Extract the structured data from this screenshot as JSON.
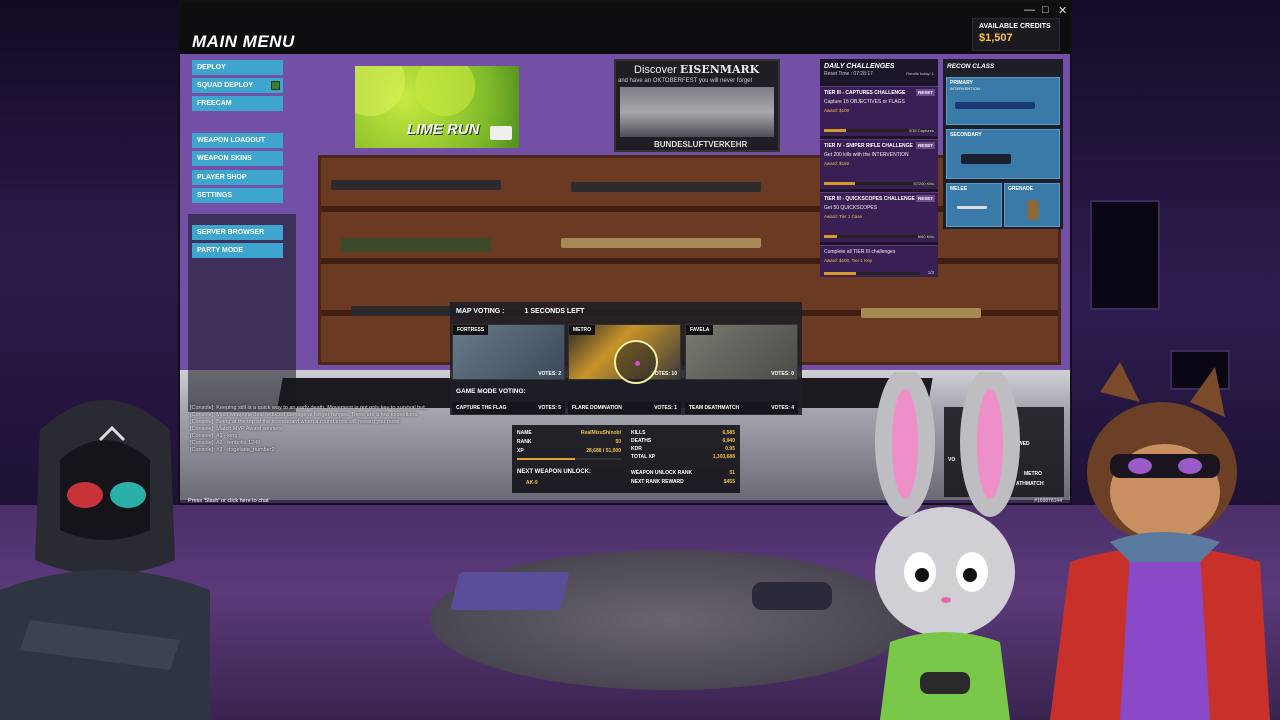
{
  "window": {
    "title": "MAIN MENU",
    "controls": [
      "—",
      "□",
      "✕"
    ]
  },
  "credits": {
    "label": "AVAILABLE CREDITS",
    "amount": "$1,507"
  },
  "menu": {
    "primary": [
      {
        "label": "DEPLOY"
      },
      {
        "label": "SQUAD DEPLOY",
        "checkbox": true
      },
      {
        "label": "FREECAM"
      }
    ],
    "secondary": [
      {
        "label": "WEAPON LOADOUT"
      },
      {
        "label": "WEAPON SKINS"
      },
      {
        "label": "PLAYER SHOP"
      },
      {
        "label": "SETTINGS"
      }
    ],
    "tertiary": [
      {
        "label": "SERVER BROWSER"
      },
      {
        "label": "PARTY MODE"
      }
    ]
  },
  "ads": {
    "lime": {
      "text": "LIME RUN"
    },
    "eisenmark": {
      "line1_prefix": "Discover",
      "line1_brand": "EISENMARK",
      "line2": "and have an OKTOBERFEST you will never forget",
      "line3": "BUNDESLUFTVERKEHR"
    }
  },
  "challenges": {
    "title": "DAILY CHALLENGES",
    "reset": "Reset Time : 07:28:17",
    "rerolls": "Rerolls today: 1",
    "items": [
      {
        "title": "TIER III - CAPTURES CHALLENGE",
        "reset": "RESET",
        "desc": "Capture 15 OBJECTIVES or FLAGS",
        "award": "Award: $100",
        "progress": "3/15 Captures",
        "fill": 0.2
      },
      {
        "title": "TIER IV - SNIPER RIFLE CHALLENGE",
        "reset": "RESET",
        "desc": "Get 200 kills with the INTERVENTION",
        "award": "Award: $150",
        "progress": "57/200 Kills",
        "fill": 0.285
      },
      {
        "title": "TIER III - QUICKSCOPES CHALLENGE",
        "reset": "RESET",
        "desc": "Get 50 QUICKSCOPES",
        "award": "Award: Tier 1 Case",
        "progress": "6/50 Kills",
        "fill": 0.12
      }
    ],
    "final": {
      "desc": "Complete all TIER III challenges",
      "award": "Award: $100, Tier 1 Key",
      "progress": "1/3",
      "fill": 0.33
    }
  },
  "recon": {
    "title": "RECON CLASS",
    "primary": {
      "label": "PRIMARY",
      "weapon": "INTERVENTION"
    },
    "secondary": {
      "label": "SECONDARY"
    },
    "melee": {
      "label": "MELEE"
    },
    "grenade": {
      "label": "GRENADE"
    }
  },
  "voting": {
    "title": "MAP VOTING :",
    "timer": "1 SECONDS LEFT",
    "maps": [
      {
        "name": "FORTRESS",
        "votes": "VOTES: 2"
      },
      {
        "name": "METRO",
        "votes": "VOTES: 10"
      },
      {
        "name": "FAVELA",
        "votes": "VOTES: 0"
      }
    ],
    "mode_title": "GAME MODE VOTING:",
    "modes": [
      {
        "name": "CAPTURE THE FLAG",
        "votes": "VOTES: 5"
      },
      {
        "name": "FLARE DOMINATION",
        "votes": "VOTES: 1"
      },
      {
        "name": "TEAM DEATHMATCH",
        "votes": "VOTES: 4"
      }
    ]
  },
  "chat": {
    "lines": [
      "[Console]: Keeping still is a quick way to an early death. Movement is not only key to survival but...",
      "[Console]: Most weapons deal reduced damage at longer ranges. There are a few exceptions.",
      "[Console]: Being at the top of the scoreboard when a round ends will reward you more.",
      "[Console]: Match MVP Award winners:",
      "[Console]: #1 - king",
      "[Console]: #2 - tenbolts 1249",
      "[Console]: #3 - dogelatte_number2"
    ],
    "hint": "Press 'Slash' or click here to chat",
    "server_id": "#169876144"
  },
  "stats": {
    "left": [
      {
        "k": "NAME",
        "v": "RealMizuShinobi"
      },
      {
        "k": "RANK",
        "v": "50"
      },
      {
        "k": "XP",
        "v": "28,688 / 51,000"
      }
    ],
    "right": [
      {
        "k": "KILLS",
        "v": "6,585"
      },
      {
        "k": "DEATHS",
        "v": "6,940"
      },
      {
        "k": "KDR",
        "v": "0.95"
      },
      {
        "k": "TOTAL XP",
        "v": "1,303,688"
      }
    ],
    "xp_fill": 0.56,
    "unlock_label": "NEXT WEAPON UNLOCK:",
    "unlock_weapon": "AK-9",
    "unlock_rank_label": "WEAPON UNLOCK RANK",
    "unlock_rank": "51",
    "reward_label": "NEXT RANK REWARD",
    "reward": "$455"
  },
  "right_frame": {
    "vote_label": "VO",
    "maps": [
      "METRO",
      "ATHMATCH"
    ],
    "extra": "WED"
  },
  "colors": {
    "accent_blue": "#3ea5cf",
    "gold": "#f3c34a",
    "purple_wall": "#7350a6"
  }
}
